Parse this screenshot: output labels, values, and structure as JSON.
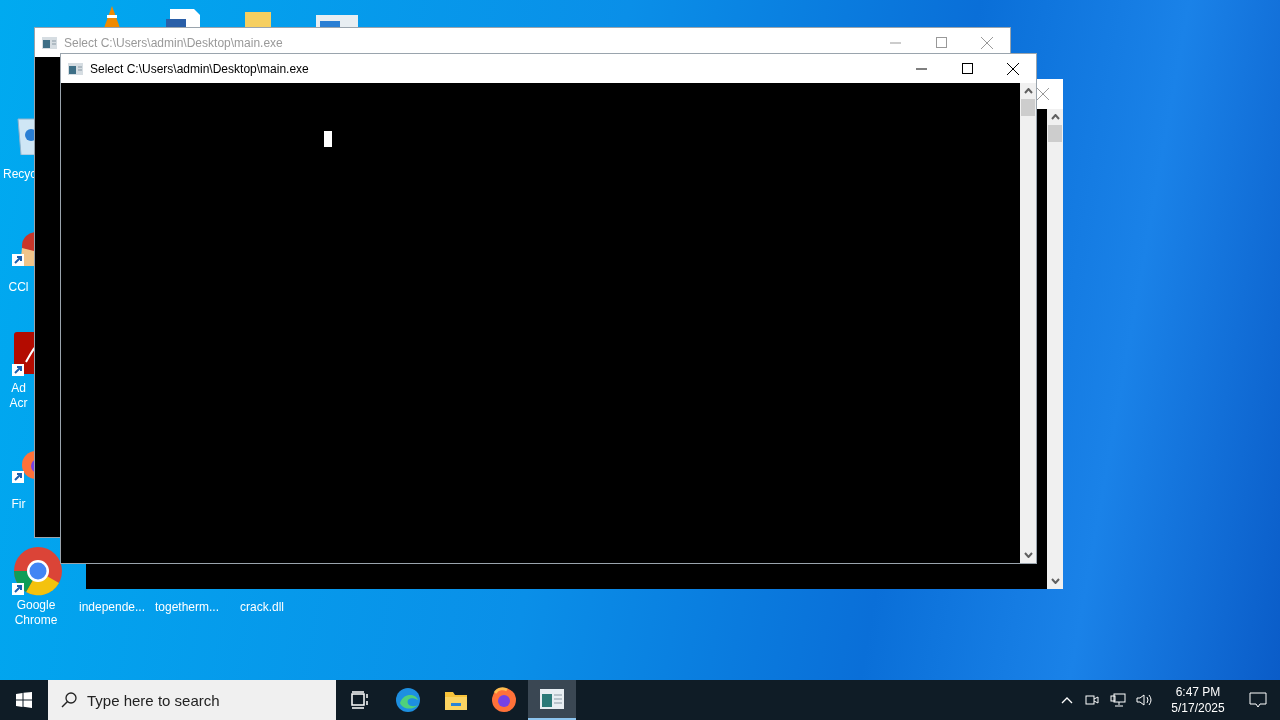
{
  "desktop_icons": [
    {
      "label": "Recyc",
      "kind": "recycle"
    },
    {
      "label": "CCl",
      "kind": "ccleaner"
    },
    {
      "label": "Ad Acr",
      "kind": "acrobat"
    },
    {
      "label": "Fir",
      "kind": "firefox"
    },
    {
      "label": "Google Chrome",
      "kind": "chrome"
    }
  ],
  "file_icons": [
    {
      "label": "independe..."
    },
    {
      "label": "togetherm..."
    },
    {
      "label": "crack.dll"
    }
  ],
  "windows": [
    {
      "title": "Select C:\\Users\\admin\\Desktop\\main.exe",
      "active": false
    },
    {
      "title": "Select C:\\Users\\admin\\Desktop\\main.exe",
      "active": true
    }
  ],
  "taskbar": {
    "search": {
      "placeholder": "Type here to search"
    },
    "apps": [
      {
        "kind": "taskview",
        "selected": false
      },
      {
        "kind": "edge",
        "selected": false
      },
      {
        "kind": "explorer",
        "selected": false
      },
      {
        "kind": "firefox",
        "selected": false
      },
      {
        "kind": "console",
        "selected": true
      }
    ],
    "clock": {
      "time": "6:47 PM",
      "date": "5/17/2025"
    }
  }
}
